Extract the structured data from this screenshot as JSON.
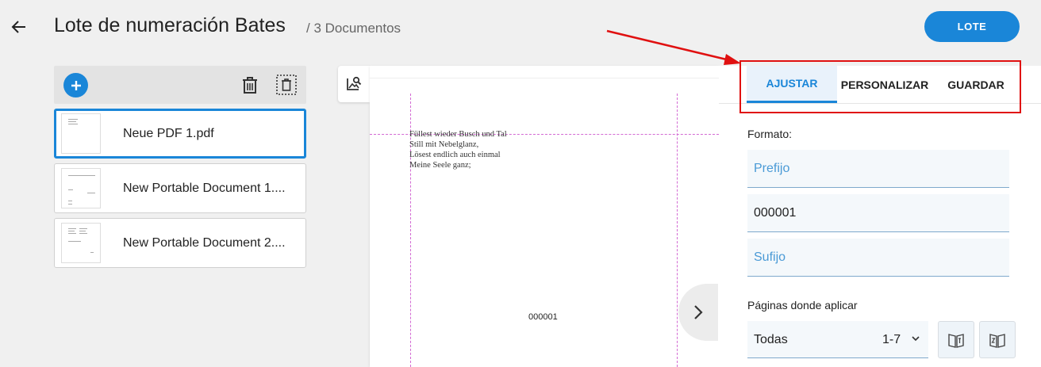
{
  "header": {
    "title": "Lote de numeración Bates",
    "subtitle": "/ 3 Documentos",
    "lote_button": "LOTE"
  },
  "documents": [
    {
      "name": "Neue PDF 1.pdf",
      "selected": true
    },
    {
      "name": "New Portable Document 1....",
      "selected": false
    },
    {
      "name": "New Portable Document 2....",
      "selected": false
    }
  ],
  "preview": {
    "poem_lines": [
      "Füllest wieder Busch und Tal",
      "Still mit Nebelglanz,",
      "Lösest endlich auch einmal",
      "Meine Seele ganz;"
    ],
    "bates_stamp": "000001"
  },
  "panel": {
    "tabs": [
      "AJUSTAR",
      "PERSONALIZAR",
      "GUARDAR"
    ],
    "active_tab": "AJUSTAR",
    "format_label": "Formato:",
    "prefix_placeholder": "Prefijo",
    "number_value": "000001",
    "suffix_placeholder": "Sufijo",
    "pages_label": "Páginas donde aplicar",
    "pages_select": "Todas",
    "pages_range": "1-7"
  },
  "colors": {
    "accent": "#1a86d8",
    "annotation_red": "#e01010",
    "guide_magenta": "#d36ad3"
  }
}
